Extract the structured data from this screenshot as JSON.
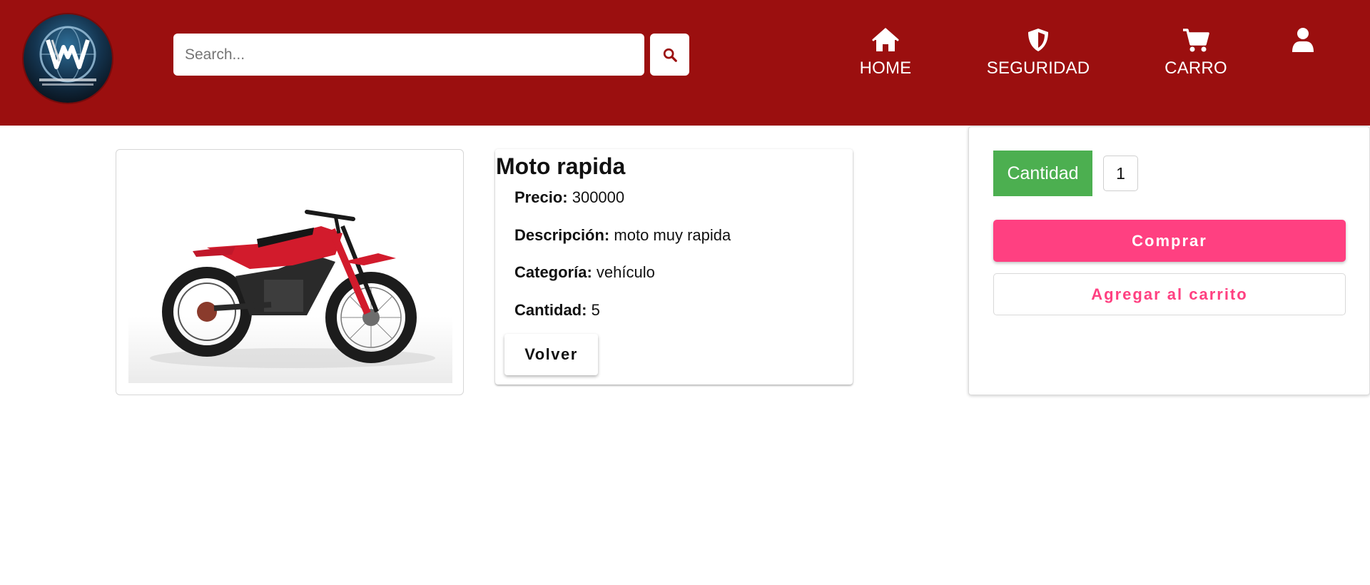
{
  "header": {
    "background": "#9b0f0f",
    "logo": {
      "icon": "ww-globe-logo"
    },
    "search": {
      "placeholder": "Search...",
      "value": "",
      "icon": "search-icon"
    },
    "nav": [
      {
        "label": "HOME",
        "icon": "home-icon"
      },
      {
        "label": "SEGURIDAD",
        "icon": "shield-icon"
      },
      {
        "label": "CARRO",
        "icon": "cart-icon"
      },
      {
        "label": "",
        "icon": "user-icon"
      }
    ]
  },
  "product": {
    "image": "red-dirt-bike",
    "title": "Moto rapida",
    "fields": [
      {
        "label": "Precio:",
        "value": "300000"
      },
      {
        "label": "Descripción:",
        "value": "moto muy rapida"
      },
      {
        "label": "Categoría:",
        "value": "vehículo"
      },
      {
        "label": "Cantidad:",
        "value": "5"
      }
    ],
    "back_label": "Volver"
  },
  "purchase": {
    "quantity_label": "Cantidad",
    "quantity_value": "1",
    "buy_label": "Comprar",
    "add_to_cart_label": "Agregar al carrito",
    "accent_color": "#ff4081",
    "quantity_color": "#4caf50"
  }
}
